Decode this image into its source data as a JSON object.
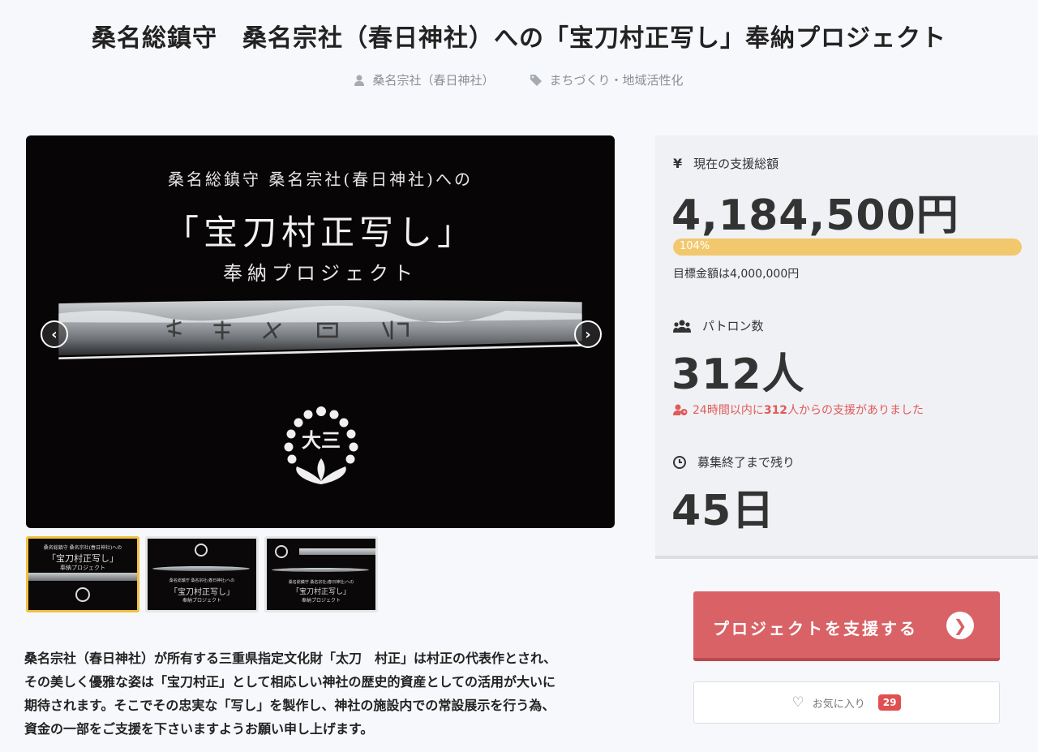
{
  "page": {
    "title": "桑名総鎮守　桑名宗社（春日神社）への「宝刀村正写し」奉納プロジェクト"
  },
  "meta": {
    "owner": "桑名宗社（春日神社）",
    "category": "まちづくり・地域活性化"
  },
  "hero": {
    "subtitle": "桑名総鎮守 桑名宗社(春日神社)への",
    "main": "「宝刀村正写し」",
    "sub2": "奉納プロジェクト",
    "crest_text": "大三"
  },
  "thumbnails": [
    {
      "line1": "桑名総鎮守 桑名宗社(春日神社)への",
      "line2": "「宝刀村正写し」",
      "line3": "奉納プロジェクト"
    },
    {
      "line1": "桑名総鎮守 桑名宗社(春日神社)への",
      "line2": "「宝刀村正写し」",
      "line3": "奉納プロジェクト"
    },
    {
      "line1": "桑名総鎮守 桑名宗社(春日神社)への",
      "line2": "「宝刀村正写し」",
      "line3": "奉納プロジェクト"
    }
  ],
  "description": [
    "桑名宗社（春日神社）が所有する三重県指定文化財「太刀　村正」は村正の代表作とされ、",
    "その美しく優雅な姿は「宝刀村正」として相応しい神社の歴史的資産としての活用が大いに",
    "期待されます。そこでその忠実な「写し」を製作し、神社の施設内での常設展示を行う為、",
    "資金の一部をご支援を下さいますようお願い申し上げます。"
  ],
  "stats": {
    "total_label": "現在の支援総額",
    "total_value": "4,184,500円",
    "progress_text": "104%",
    "progress_fraction": 1.04,
    "goal_text": "目標金額は4,000,000円",
    "patron_label": "パトロン数",
    "patron_value": "312人",
    "recent_prefix": "24時間以内に",
    "recent_count": "312",
    "recent_suffix": "人からの支援がありました",
    "remaining_label": "募集終了まで残り",
    "remaining_value": "45日"
  },
  "actions": {
    "support_label": "プロジェクトを支援する",
    "favorite_label": "お気に入り",
    "favorite_count": "29"
  },
  "colors": {
    "support": "#d96266",
    "progress": "#f2c86e",
    "recent": "#e05a5a",
    "thumb_active": "#f0c040"
  }
}
